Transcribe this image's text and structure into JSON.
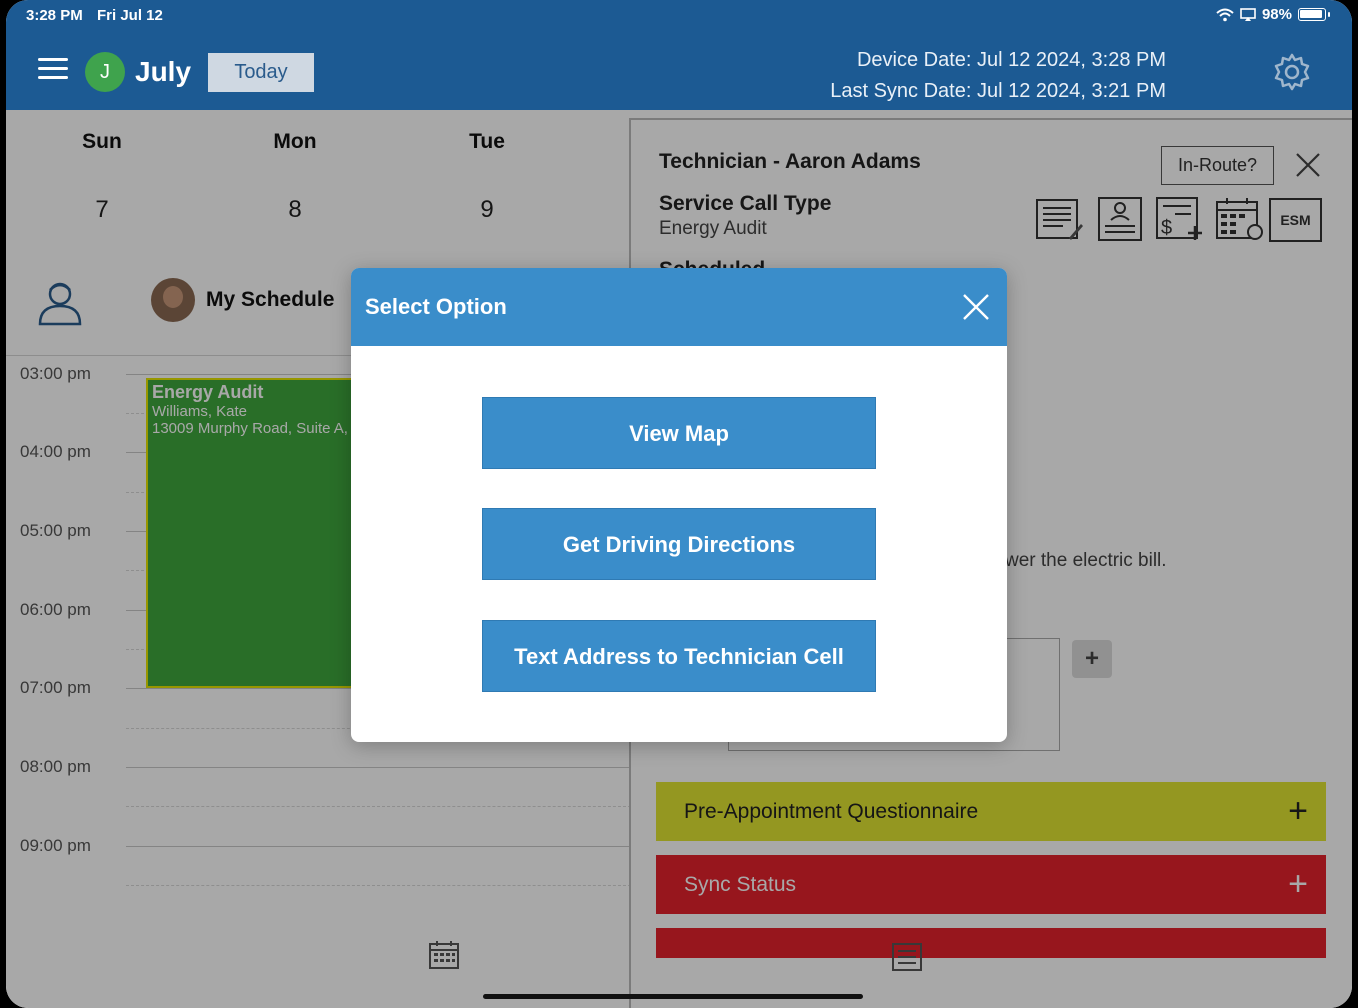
{
  "status_bar": {
    "time": "3:28 PM",
    "date": "Fri Jul 12",
    "battery": "98%"
  },
  "header": {
    "avatar_initial": "J",
    "month": "July",
    "today_button": "Today",
    "device_date": "Device Date: Jul 12 2024, 3:28 PM",
    "last_sync_date": "Last Sync Date: Jul 12 2024, 3:21 PM"
  },
  "calendar": {
    "days": [
      {
        "name": "Sun",
        "number": "7"
      },
      {
        "name": "Mon",
        "number": "8"
      },
      {
        "name": "Tue",
        "number": "9"
      }
    ],
    "my_schedule": "My Schedule",
    "times": [
      "03:00 pm",
      "04:00 pm",
      "05:00 pm",
      "06:00 pm",
      "07:00 pm",
      "08:00 pm",
      "09:00 pm"
    ],
    "event": {
      "title": "Energy Audit",
      "customer": "Williams, Kate",
      "address": "13009 Murphy Road, Suite A,"
    }
  },
  "detail": {
    "technician": "Technician - Aaron Adams",
    "in_route": "In-Route?",
    "service_call_type_label": "Service Call Type",
    "service_call_type_value": "Energy Audit",
    "scheduled_label": "Scheduled",
    "esm": "ESM",
    "note_fragment": "wer the electric bill.",
    "add": "+",
    "sections": [
      {
        "label": "Pre-Appointment Questionnaire",
        "expand": "+"
      },
      {
        "label": "Sync Status",
        "expand": "+"
      }
    ]
  },
  "modal": {
    "title": "Select Option",
    "buttons": [
      "View Map",
      "Get Driving Directions",
      "Text Address to Technician Cell"
    ]
  },
  "colors": {
    "header_blue": "#1c5a93",
    "modal_blue": "#3a8dca",
    "event_green": "#3fa83d",
    "section_yellow": "#e1e632",
    "section_red": "#e5222d"
  }
}
